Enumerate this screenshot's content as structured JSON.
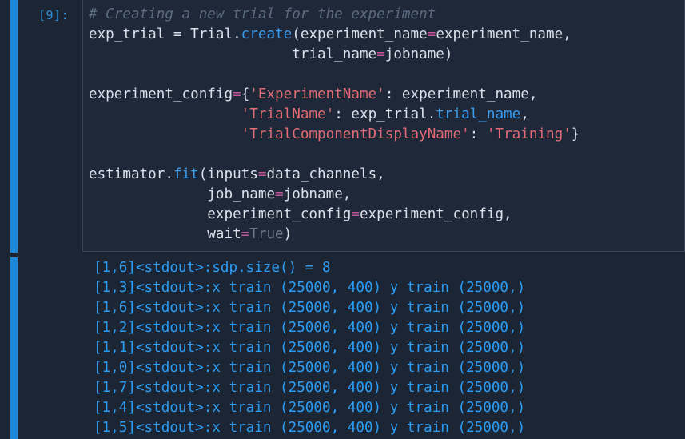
{
  "cell": {
    "prompt": "[9]:",
    "code": {
      "comment": "# Creating a new trial for the experiment",
      "l2_a": "exp_trial = Trial.",
      "l2_attr": "create",
      "l2_b": "(experiment_name",
      "l2_eq": "=",
      "l2_c": "experiment_name,",
      "l3_pad": "                        ",
      "l3_a": "trial_name",
      "l3_eq": "=",
      "l3_b": "jobname)",
      "l5_a": "experiment_config",
      "l5_eq": "=",
      "l5_b": "{",
      "l5_str": "'ExperimentName'",
      "l5_c": ": experiment_name,",
      "l6_pad": "                  ",
      "l6_str": "'TrialName'",
      "l6_a": ": exp_trial.",
      "l6_attr": "trial_name",
      "l6_b": ",",
      "l7_pad": "                  ",
      "l7_str": "'TrialComponentDisplayName'",
      "l7_a": ": ",
      "l7_str2": "'Training'",
      "l7_b": "}",
      "l9_a": "estimator.",
      "l9_attr": "fit",
      "l9_b": "(inputs",
      "l9_eq": "=",
      "l9_c": "data_channels,",
      "l10_pad": "              ",
      "l10_a": "job_name",
      "l10_eq": "=",
      "l10_b": "jobname,",
      "l11_pad": "              ",
      "l11_a": "experiment_config",
      "l11_eq": "=",
      "l11_b": "experiment_config,",
      "l12_pad": "              ",
      "l12_a": "wait",
      "l12_eq": "=",
      "l12_kw": "True",
      "l12_b": ")"
    }
  },
  "output": {
    "lines": [
      "[1,6]<stdout>:sdp.size() = 8",
      "[1,3]<stdout>:x train (25000, 400) y train (25000,)",
      "[1,6]<stdout>:x train (25000, 400) y train (25000,)",
      "[1,2]<stdout>:x train (25000, 400) y train (25000,)",
      "[1,1]<stdout>:x train (25000, 400) y train (25000,)",
      "[1,0]<stdout>:x train (25000, 400) y train (25000,)",
      "[1,7]<stdout>:x train (25000, 400) y train (25000,)",
      "[1,4]<stdout>:x train (25000, 400) y train (25000,)",
      "[1,5]<stdout>:x train (25000, 400) y train (25000,)"
    ]
  },
  "colors": {
    "background": "#1b2533",
    "cell_bar": "#1f87d6",
    "code_text": "#d9e0ea",
    "comment": "#5b6b80",
    "attribute": "#3b9df0",
    "operator": "#c3569c",
    "string": "#e06b75",
    "keyword": "#6e7a8a",
    "stdout": "#2d9cf3"
  }
}
